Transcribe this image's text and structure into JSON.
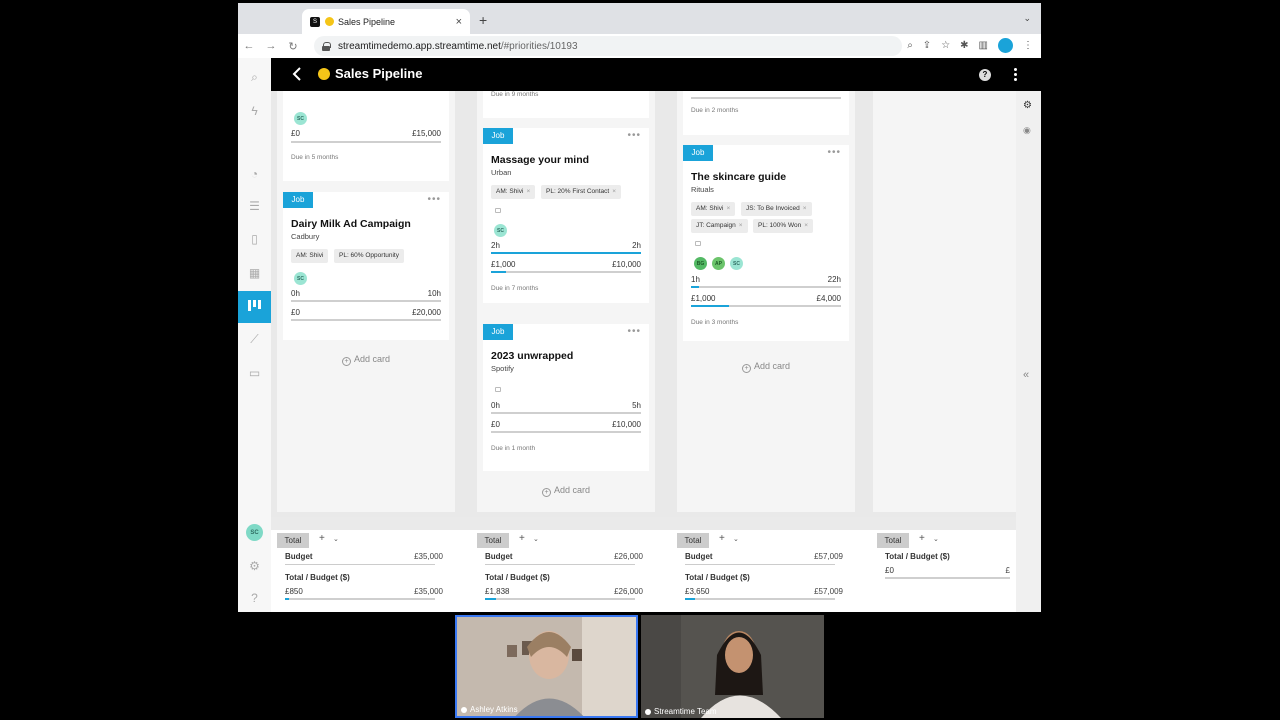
{
  "browser": {
    "tab_title": "Sales Pipeline",
    "favicon_text": "S",
    "url_host": "streamtimedemo.app.streamtime.net",
    "url_path": "/#priorities/10193"
  },
  "app": {
    "title": "Sales Pipeline",
    "help_glyph": "?"
  },
  "sidebar": {
    "user_initials": "SC"
  },
  "columns": [
    {
      "add_card_label": "Add card",
      "partial_card": {
        "assignee": "SC",
        "actual": "£0",
        "budget": "£15,000",
        "due": "Due in 5 months"
      },
      "cards": [
        {
          "tag": "Job",
          "title": "Dairy Milk Ad Campaign",
          "client": "Cadbury",
          "chips": [
            "AM: Shivi",
            "PL: 60% Opportunity"
          ],
          "assignees": [
            "SC"
          ],
          "hours_used": "0h",
          "hours_planned": "10h",
          "spent": "£0",
          "budget": "£20,000",
          "hours_progress": 0,
          "budget_progress": 0
        }
      ]
    },
    {
      "add_card_label": "Add card",
      "partial_due": "Due in 9 months",
      "cards": [
        {
          "tag": "Job",
          "title": "Massage your mind",
          "client": "Urban",
          "chips": [
            "AM: Shivi",
            "PL: 20% First Contact"
          ],
          "assignees": [
            "SC"
          ],
          "hours_used": "2h",
          "hours_planned": "2h",
          "spent": "£1,000",
          "budget": "£10,000",
          "hours_progress": 1.0,
          "budget_progress": 0.1,
          "due": "Due in 7 months"
        },
        {
          "tag": "Job",
          "title": "2023 unwrapped",
          "client": "Spotify",
          "chips": [],
          "assignees": [],
          "hours_used": "0h",
          "hours_planned": "5h",
          "spent": "£0",
          "budget": "£10,000",
          "hours_progress": 0,
          "budget_progress": 0,
          "due": "Due in 1 month"
        }
      ]
    },
    {
      "add_card_label": "Add card",
      "partial_due": "Due in 2 months",
      "cards": [
        {
          "tag": "Job",
          "title": "The skincare guide",
          "client": "Rituals",
          "chips": [
            "AM: Shivi",
            "JS: To Be Invoiced",
            "JT: Campaign",
            "PL: 100% Won"
          ],
          "assignees": [
            "BG",
            "AP",
            "SC"
          ],
          "hours_used": "1h",
          "hours_planned": "22h",
          "spent": "£1,000",
          "budget": "£4,000",
          "hours_progress": 0.05,
          "budget_progress": 0.25,
          "due": "Due in 3 months"
        }
      ]
    },
    {
      "empty": true
    }
  ],
  "totals": [
    {
      "label": "Total",
      "budget_label": "Budget",
      "budget_value": "£35,000",
      "tb_label": "Total / Budget ($)",
      "spent": "£850",
      "budget": "£35,000",
      "progress": 0.024
    },
    {
      "label": "Total",
      "budget_label": "Budget",
      "budget_value": "£26,000",
      "tb_label": "Total / Budget ($)",
      "spent": "£1,838",
      "budget": "£26,000",
      "progress": 0.07
    },
    {
      "label": "Total",
      "budget_label": "Budget",
      "budget_value": "£57,009",
      "tb_label": "Total / Budget ($)",
      "spent": "£3,650",
      "budget": "£57,009",
      "progress": 0.064
    },
    {
      "label": "Total",
      "tb_label": "Total / Budget ($)",
      "spent": "£0",
      "budget": "£"
    }
  ],
  "video": {
    "participants": [
      {
        "name": "Ashley Atkins"
      },
      {
        "name": "Streamtime Team"
      }
    ]
  },
  "colors": {
    "accent": "#1aa3d9",
    "avatar_sc": "#9be5d3",
    "header": "#000000"
  }
}
